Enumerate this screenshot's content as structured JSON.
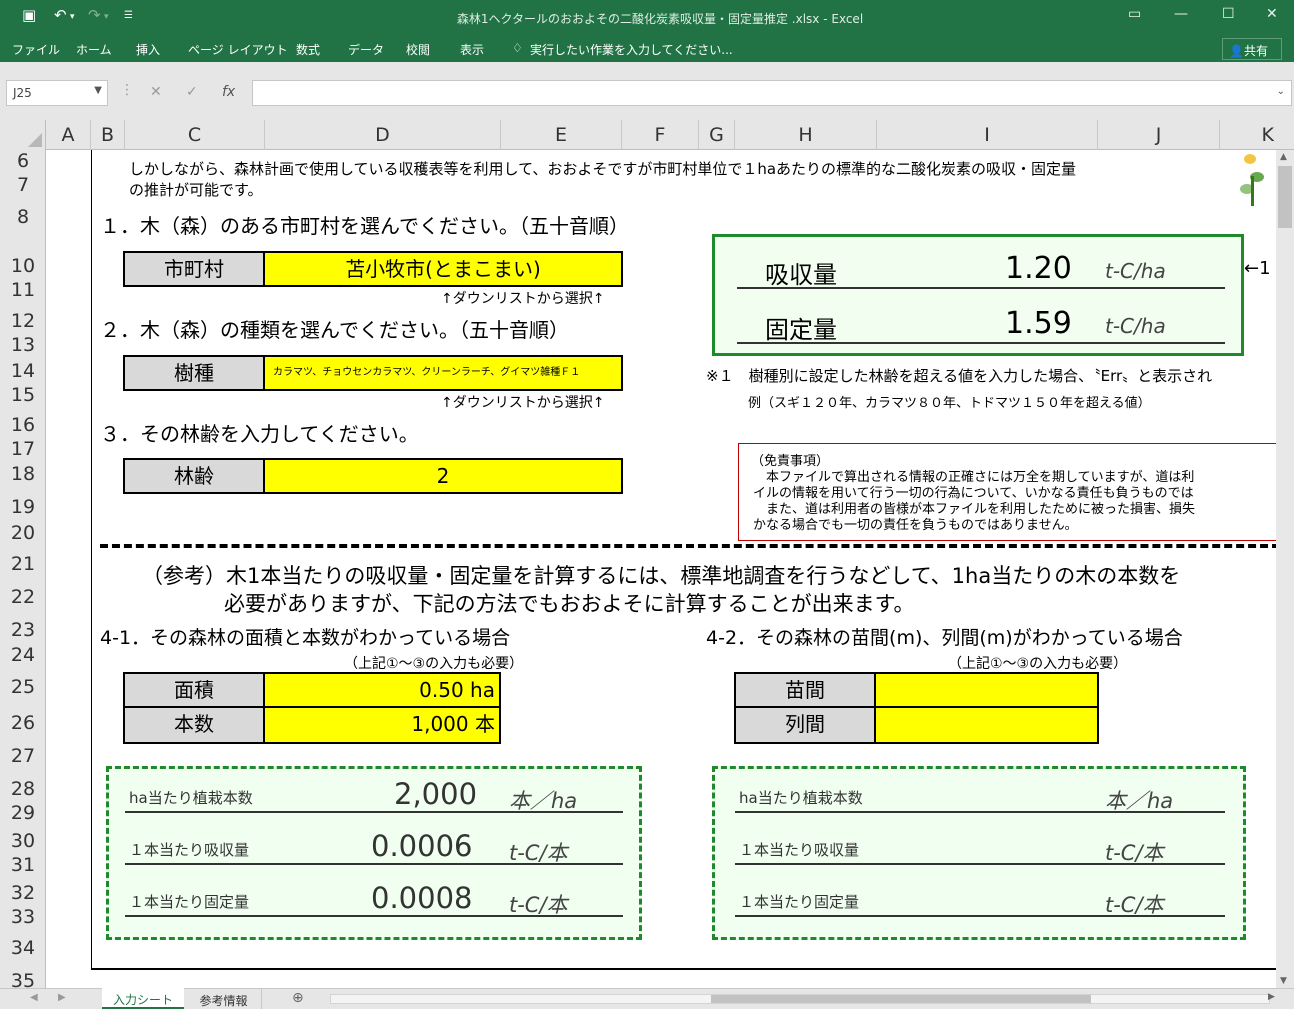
{
  "window": {
    "title": "森林1ヘクタールのおおよその二酸化炭素吸収量・固定量推定 .xlsx - Excel"
  },
  "ribbon": {
    "tabs": [
      "ファイル",
      "ホーム",
      "挿入",
      "ページ レイアウト",
      "数式",
      "データ",
      "校閲",
      "表示"
    ],
    "tell_me": "実行したい作業を入力してください...",
    "share": "共有"
  },
  "formula_bar": {
    "name_box": "J25",
    "fx": "fx"
  },
  "columns": [
    "A",
    "B",
    "C",
    "D",
    "E",
    "F",
    "G",
    "H",
    "I",
    "J",
    "K"
  ],
  "rows": [
    "6",
    "7",
    "8",
    "10",
    "11",
    "12",
    "13",
    "14",
    "15",
    "16",
    "17",
    "18",
    "19",
    "20",
    "21",
    "22",
    "23",
    "24",
    "25",
    "26",
    "27",
    "28",
    "29",
    "30",
    "31",
    "32",
    "33",
    "34",
    "35"
  ],
  "sheet": {
    "intro_line1": "しかしながら、森林計画で使用している収穫表等を利用して、おおよそですが市町村単位で１haあたりの標準的な二酸化炭素の吸収・固定量",
    "intro_line2": "の推計が可能です。",
    "step1": "１．木（森）のある市町村を選んでください。（五十音順）",
    "municipality_label": "市町村",
    "municipality_value": "苫小牧市(とまこまい)",
    "dropdown_hint": "↑ダウンリストから選択↑",
    "step2": "２．木（森）の種類を選んでください。（五十音順）",
    "species_label": "樹種",
    "species_value": "カラマツ、チョウセンカラマツ、クリーンラーチ、グイマツ雑種Ｆ１",
    "step3": "３．その林齢を入力してください。",
    "age_label": "林齢",
    "age_value": "2",
    "result": {
      "absorb_label": "吸収量",
      "absorb_value": "1.20",
      "absorb_unit": "t-C/ha",
      "fixed_label": "固定量",
      "fixed_value": "1.59",
      "fixed_unit": "t-C/ha",
      "side_mark": "←1"
    },
    "note1": "※１　樹種別に設定した林齢を超える値を入力した場合、〝Err〟と表示され",
    "note2": "例（スギ１２０年、カラマツ８０年、トドマツ１５０年を超える値）",
    "disclaimer": {
      "title": "（免責事項）",
      "l1": "　本ファイルで算出される情報の正確さには万全を期していますが、道は利",
      "l2": "イルの情報を用いて行う一切の行為について、いかなる責任も負うものでは",
      "l3": "　また、道は利用者の皆様が本ファイルを利用したために被った損害、損失",
      "l4": "かなる場合でも一切の責任を負うものではありません。"
    },
    "ref1": "（参考）木1本当たりの吸収量・固定量を計算するには、標準地調査を行うなどして、1ha当たりの木の本数を",
    "ref2": "必要がありますが、下記の方法でもおおよそに計算することが出来ます。",
    "s41": "4-1．その森林の面積と本数がわかっている場合",
    "s42": "4-2．その森林の苗間(m)、列間(m)がわかっている場合",
    "also_needed": "（上記①～③の入力も必要）",
    "area_label": "面積",
    "area_value": "0.50 ha",
    "count_label": "本数",
    "count_value": "1,000 本",
    "spacing_label": "苗間",
    "row_label": "列間",
    "left_calc": {
      "r1_label": "ha当たり植栽本数",
      "r1_value": "2,000",
      "r1_unit": "本／ha",
      "r2_label": "１本当たり吸収量",
      "r2_value": "0.0006",
      "r2_unit": "t-C/本",
      "r3_label": "１本当たり固定量",
      "r3_value": "0.0008",
      "r3_unit": "t-C/本"
    },
    "right_calc": {
      "r1_label": "ha当たり植栽本数",
      "r1_unit": "本／ha",
      "r2_label": "１本当たり吸収量",
      "r2_unit": "t-C/本",
      "r3_label": "１本当たり固定量",
      "r3_unit": "t-C/本"
    }
  },
  "sheet_tabs": {
    "active": "入力シート",
    "other": "参考情報"
  },
  "colors": {
    "excel_green": "#217346",
    "highlight": "#ffff00",
    "box_green": "#1e8a2c"
  }
}
